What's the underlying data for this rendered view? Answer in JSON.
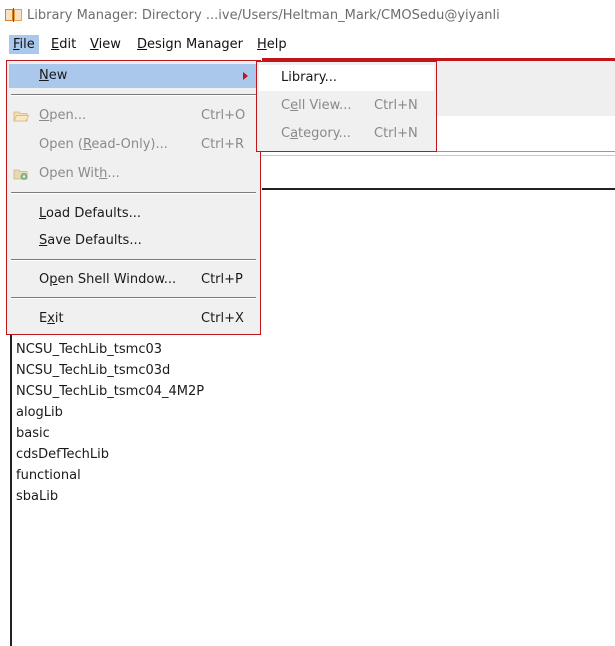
{
  "window": {
    "title": "Library Manager: Directory ...ive/Users/Heltman_Mark/CMOSedu@yiyanli",
    "icon": "library-book-icon"
  },
  "menubar": {
    "items": [
      {
        "label": "File",
        "mnemonic": "F",
        "rest": "ile"
      },
      {
        "label": "Edit",
        "mnemonic": "E",
        "rest": "dit"
      },
      {
        "label": "View",
        "mnemonic": "V",
        "rest": "iew"
      },
      {
        "label": "Design Manager",
        "mnemonic": "D",
        "rest": "esign Manager"
      },
      {
        "label": "Help",
        "mnemonic": "H",
        "rest": "elp"
      }
    ]
  },
  "file_menu": {
    "new": {
      "label": "New",
      "u": "N",
      "rest": "ew"
    },
    "open": {
      "label": "Open...",
      "u": "O",
      "rest": "pen...",
      "shortcut": "Ctrl+O",
      "icon": "folder-open-icon"
    },
    "open_ro": {
      "pre": "Open (",
      "u": "R",
      "rest": "ead-Only)...",
      "shortcut": "Ctrl+R"
    },
    "open_with": {
      "pre": "Open Wit",
      "u": "h",
      "rest": "...",
      "icon": "folder-gear-icon"
    },
    "load_defaults": {
      "u": "L",
      "rest": "oad Defaults..."
    },
    "save_defaults": {
      "u": "S",
      "rest": "ave Defaults..."
    },
    "open_shell": {
      "pre": "O",
      "u": "p",
      "rest": "en Shell Window...",
      "shortcut": "Ctrl+P"
    },
    "exit": {
      "pre": "E",
      "u": "x",
      "rest": "it",
      "shortcut": "Ctrl+X"
    }
  },
  "new_submenu": {
    "library": "Library...",
    "cell_view": {
      "pre": "C",
      "u": "e",
      "rest": "ll View...",
      "shortcut": "Ctrl+N"
    },
    "category": {
      "pre": "C",
      "u": "a",
      "rest": "tegory...",
      "shortcut": "Ctrl+N"
    }
  },
  "libraries": [
    "NCSU_TechLib_tsmc03",
    "NCSU_TechLib_tsmc03d",
    "NCSU_TechLib_tsmc04_4M2P",
    "alogLib",
    "basic",
    "cdsDefTechLib",
    "functional",
    "sbaLib"
  ],
  "colors": {
    "highlight": "#a9c8ec",
    "outline_red": "#c0151b",
    "disabled_text": "#8a8a8a"
  }
}
